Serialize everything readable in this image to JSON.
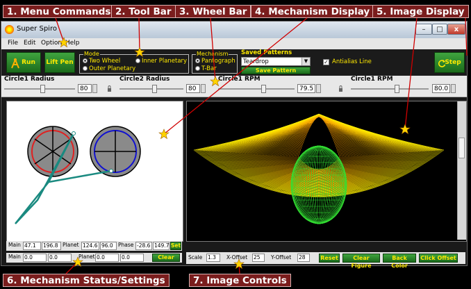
{
  "callouts": {
    "c1": "1. Menu Commands",
    "c2": "2. Tool Bar",
    "c3": "3. Wheel Bar",
    "c4": "4. Mechanism Display",
    "c5": "5. Image Display",
    "c6": "6. Mechanism Status/Settings",
    "c7": "7. Image Controls"
  },
  "window": {
    "title": "Super Spiro",
    "minimize": "–",
    "maximize": "□",
    "close": "x"
  },
  "menu": [
    "File",
    "Edit",
    "Options",
    "Help"
  ],
  "toolbar": {
    "run": "Run",
    "lift_pen": "Lift Pen",
    "mode": {
      "legend": "Mode",
      "two_wheel": "Two Wheel",
      "outer_planetary": "Outer Planetary",
      "inner_planetary": "Inner Planetary"
    },
    "mechanism": {
      "legend": "Mechanism",
      "pantograph": "Pantograph",
      "tbar": "T-Bar"
    },
    "saved_patterns": {
      "label": "Saved Patterns",
      "selected": "Teardrop",
      "save_button": "Save Pattern"
    },
    "antialias": "Antialias Line",
    "step": "Step"
  },
  "wheelbar": {
    "circle1_radius": {
      "label": "Circle1 Radius",
      "value": "80",
      "fraction": 0.55
    },
    "circle2_radius": {
      "label": "Circle2 Radius",
      "value": "80",
      "fraction": 0.55
    },
    "circle1_rpm": {
      "label": "Circle1 RPM",
      "value": "79.5",
      "fraction": 0.6
    },
    "circle2_rpm": {
      "label": "Circle1 RPM",
      "value": "80.0",
      "fraction": 0.6
    }
  },
  "status": {
    "row1": {
      "main_label": "Main",
      "main_x": "47.1",
      "main_y": "196.8",
      "planet_label": "Planet",
      "planet_x": "124.6",
      "planet_y": "96.0",
      "phase_label": "Phase",
      "phase_a": "-28.6",
      "phase_b": "149.7",
      "set_button": "Set"
    },
    "row2": {
      "main_label": "Main",
      "main_a": "0.0",
      "main_b": "0.0",
      "planet_label": "Planet",
      "planet_a": "0.0",
      "planet_b": "0.0",
      "clear_button": "Clear"
    }
  },
  "image_controls": {
    "scale_label": "Scale",
    "scale_value": "1.3",
    "xoffset_label": "X-Offset",
    "xoffset_value": "25",
    "yoffset_label": "Y-Offset",
    "yoffset_value": "28",
    "reset": "Reset",
    "clear_figure": "Clear Figure",
    "back_color": "Back Color",
    "click_offset": "Click Offset"
  },
  "colors": {
    "callout_bg": "#7a1d1d",
    "accent_yellow": "#ffe900",
    "button_green": "#2e8b2e",
    "wheel1_ring": "#e02020",
    "wheel2_ring": "#1010d0",
    "linkage": "#1a8a80",
    "pattern_outer": "#ffa000",
    "pattern_inner": "#30e030"
  }
}
